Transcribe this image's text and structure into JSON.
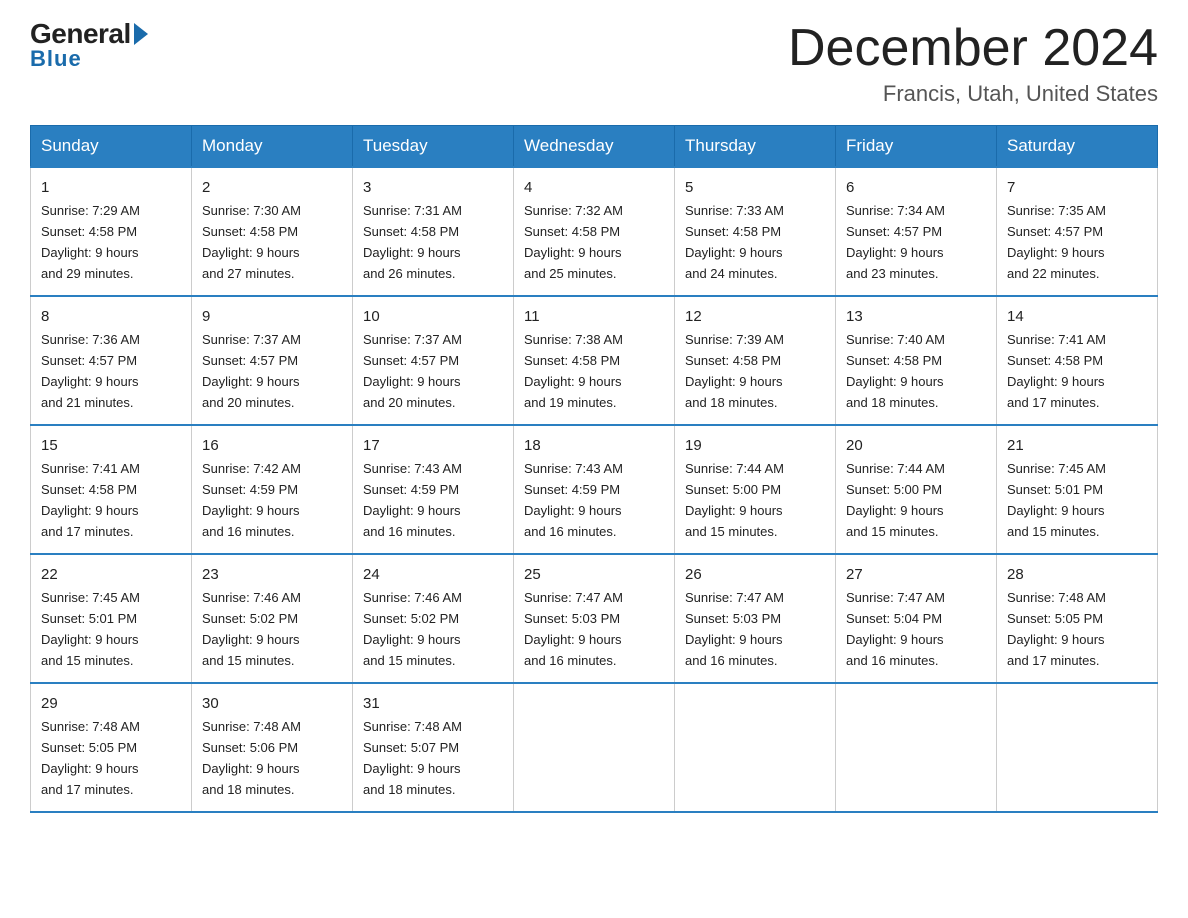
{
  "logo": {
    "name_part1": "General",
    "arrow": "▶",
    "name_part2": "Blue"
  },
  "header": {
    "month": "December 2024",
    "location": "Francis, Utah, United States"
  },
  "weekdays": [
    "Sunday",
    "Monday",
    "Tuesday",
    "Wednesday",
    "Thursday",
    "Friday",
    "Saturday"
  ],
  "weeks": [
    [
      {
        "day": "1",
        "sunrise": "7:29 AM",
        "sunset": "4:58 PM",
        "daylight": "9 hours and 29 minutes."
      },
      {
        "day": "2",
        "sunrise": "7:30 AM",
        "sunset": "4:58 PM",
        "daylight": "9 hours and 27 minutes."
      },
      {
        "day": "3",
        "sunrise": "7:31 AM",
        "sunset": "4:58 PM",
        "daylight": "9 hours and 26 minutes."
      },
      {
        "day": "4",
        "sunrise": "7:32 AM",
        "sunset": "4:58 PM",
        "daylight": "9 hours and 25 minutes."
      },
      {
        "day": "5",
        "sunrise": "7:33 AM",
        "sunset": "4:58 PM",
        "daylight": "9 hours and 24 minutes."
      },
      {
        "day": "6",
        "sunrise": "7:34 AM",
        "sunset": "4:57 PM",
        "daylight": "9 hours and 23 minutes."
      },
      {
        "day": "7",
        "sunrise": "7:35 AM",
        "sunset": "4:57 PM",
        "daylight": "9 hours and 22 minutes."
      }
    ],
    [
      {
        "day": "8",
        "sunrise": "7:36 AM",
        "sunset": "4:57 PM",
        "daylight": "9 hours and 21 minutes."
      },
      {
        "day": "9",
        "sunrise": "7:37 AM",
        "sunset": "4:57 PM",
        "daylight": "9 hours and 20 minutes."
      },
      {
        "day": "10",
        "sunrise": "7:37 AM",
        "sunset": "4:57 PM",
        "daylight": "9 hours and 20 minutes."
      },
      {
        "day": "11",
        "sunrise": "7:38 AM",
        "sunset": "4:58 PM",
        "daylight": "9 hours and 19 minutes."
      },
      {
        "day": "12",
        "sunrise": "7:39 AM",
        "sunset": "4:58 PM",
        "daylight": "9 hours and 18 minutes."
      },
      {
        "day": "13",
        "sunrise": "7:40 AM",
        "sunset": "4:58 PM",
        "daylight": "9 hours and 18 minutes."
      },
      {
        "day": "14",
        "sunrise": "7:41 AM",
        "sunset": "4:58 PM",
        "daylight": "9 hours and 17 minutes."
      }
    ],
    [
      {
        "day": "15",
        "sunrise": "7:41 AM",
        "sunset": "4:58 PM",
        "daylight": "9 hours and 17 minutes."
      },
      {
        "day": "16",
        "sunrise": "7:42 AM",
        "sunset": "4:59 PM",
        "daylight": "9 hours and 16 minutes."
      },
      {
        "day": "17",
        "sunrise": "7:43 AM",
        "sunset": "4:59 PM",
        "daylight": "9 hours and 16 minutes."
      },
      {
        "day": "18",
        "sunrise": "7:43 AM",
        "sunset": "4:59 PM",
        "daylight": "9 hours and 16 minutes."
      },
      {
        "day": "19",
        "sunrise": "7:44 AM",
        "sunset": "5:00 PM",
        "daylight": "9 hours and 15 minutes."
      },
      {
        "day": "20",
        "sunrise": "7:44 AM",
        "sunset": "5:00 PM",
        "daylight": "9 hours and 15 minutes."
      },
      {
        "day": "21",
        "sunrise": "7:45 AM",
        "sunset": "5:01 PM",
        "daylight": "9 hours and 15 minutes."
      }
    ],
    [
      {
        "day": "22",
        "sunrise": "7:45 AM",
        "sunset": "5:01 PM",
        "daylight": "9 hours and 15 minutes."
      },
      {
        "day": "23",
        "sunrise": "7:46 AM",
        "sunset": "5:02 PM",
        "daylight": "9 hours and 15 minutes."
      },
      {
        "day": "24",
        "sunrise": "7:46 AM",
        "sunset": "5:02 PM",
        "daylight": "9 hours and 15 minutes."
      },
      {
        "day": "25",
        "sunrise": "7:47 AM",
        "sunset": "5:03 PM",
        "daylight": "9 hours and 16 minutes."
      },
      {
        "day": "26",
        "sunrise": "7:47 AM",
        "sunset": "5:03 PM",
        "daylight": "9 hours and 16 minutes."
      },
      {
        "day": "27",
        "sunrise": "7:47 AM",
        "sunset": "5:04 PM",
        "daylight": "9 hours and 16 minutes."
      },
      {
        "day": "28",
        "sunrise": "7:48 AM",
        "sunset": "5:05 PM",
        "daylight": "9 hours and 17 minutes."
      }
    ],
    [
      {
        "day": "29",
        "sunrise": "7:48 AM",
        "sunset": "5:05 PM",
        "daylight": "9 hours and 17 minutes."
      },
      {
        "day": "30",
        "sunrise": "7:48 AM",
        "sunset": "5:06 PM",
        "daylight": "9 hours and 18 minutes."
      },
      {
        "day": "31",
        "sunrise": "7:48 AM",
        "sunset": "5:07 PM",
        "daylight": "9 hours and 18 minutes."
      },
      null,
      null,
      null,
      null
    ]
  ],
  "labels": {
    "sunrise": "Sunrise:",
    "sunset": "Sunset:",
    "daylight": "Daylight:"
  }
}
